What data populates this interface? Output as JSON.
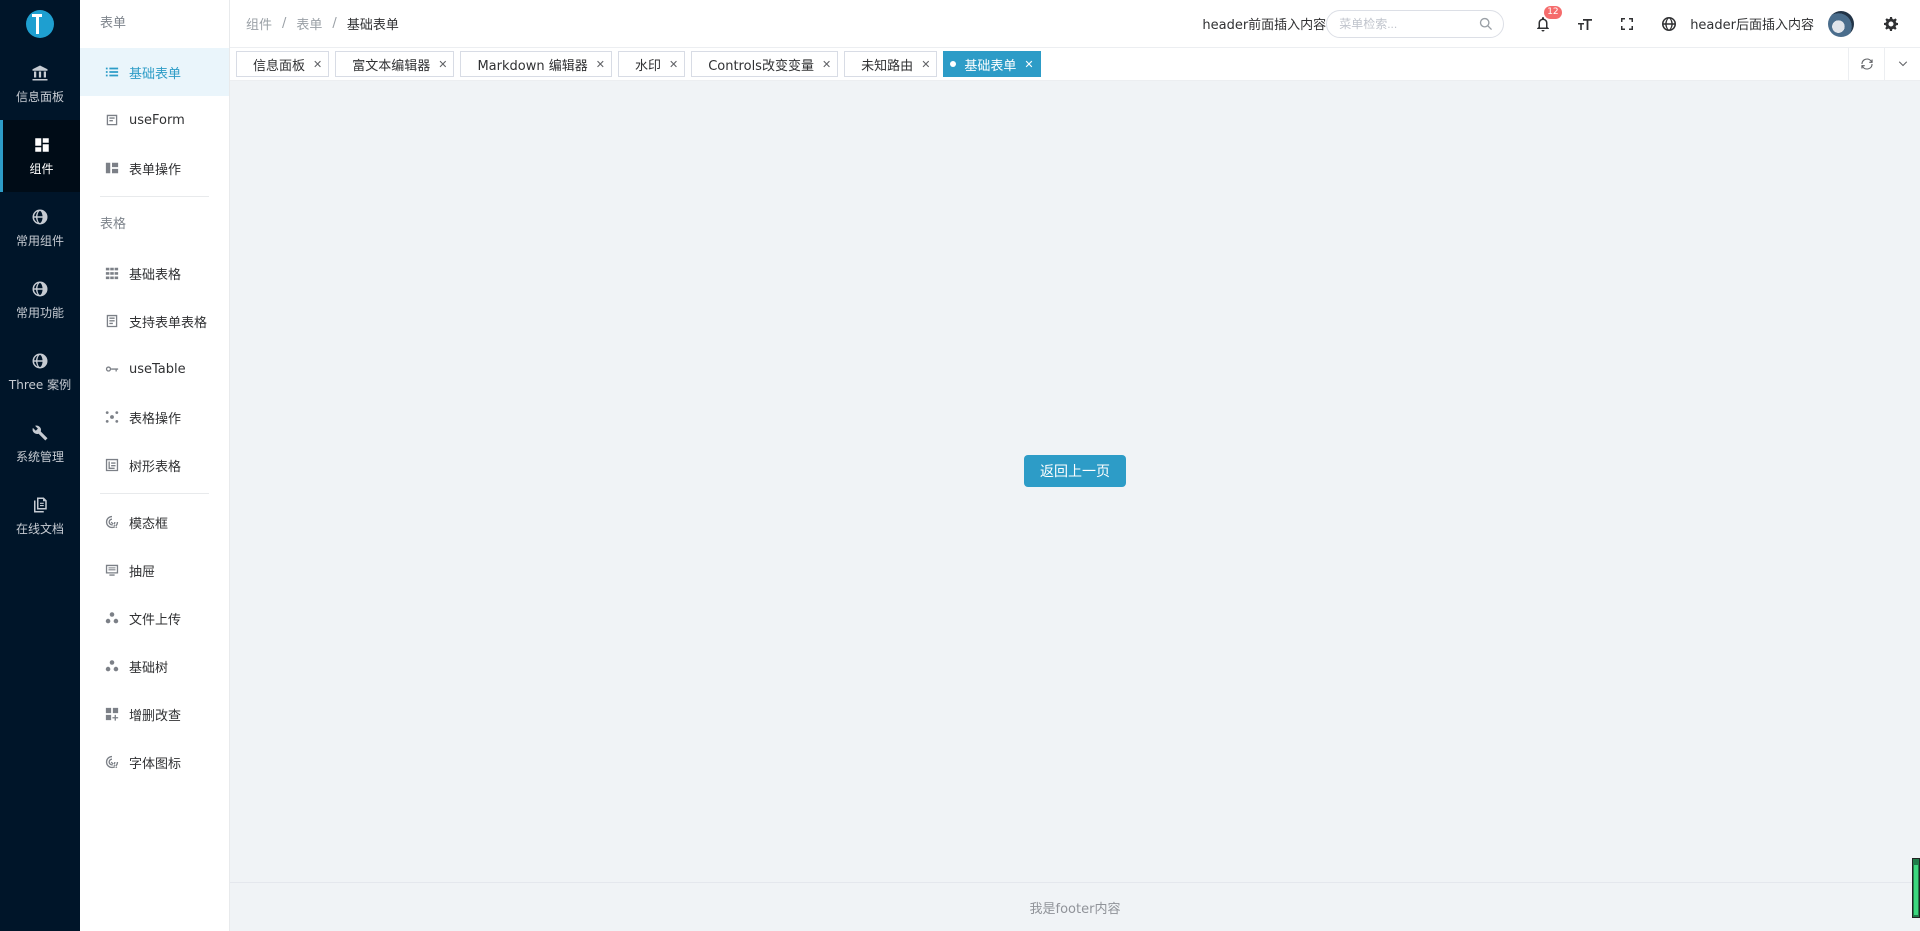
{
  "rail": {
    "items": [
      {
        "label": "信息面板",
        "icon": "bank-icon"
      },
      {
        "label": "组件",
        "icon": "dashboard-icon",
        "active": true
      },
      {
        "label": "常用组件",
        "icon": "globe-gear-icon"
      },
      {
        "label": "常用功能",
        "icon": "globe-gear-icon"
      },
      {
        "label": "Three 案例",
        "icon": "globe-gear-icon"
      },
      {
        "label": "系统管理",
        "icon": "wrench-icon"
      },
      {
        "label": "在线文档",
        "icon": "document-icon"
      }
    ]
  },
  "sidebar": {
    "group_form": "表单",
    "group_table": "表格",
    "items": [
      {
        "label": "基础表单",
        "icon": "list-icon",
        "active": true
      },
      {
        "label": "useForm",
        "icon": "form-icon"
      },
      {
        "label": "表单操作",
        "icon": "layout-icon"
      },
      {
        "label": "基础表格",
        "icon": "grid-icon"
      },
      {
        "label": "支持表单表格",
        "icon": "profile-icon"
      },
      {
        "label": "useTable",
        "icon": "key-icon"
      },
      {
        "label": "表格操作",
        "icon": "cluster-icon"
      },
      {
        "label": "树形表格",
        "icon": "tree-icon"
      },
      {
        "label": "模态框",
        "icon": "radar-icon"
      },
      {
        "label": "抽屉",
        "icon": "drawer-icon"
      },
      {
        "label": "文件上传",
        "icon": "dots-icon"
      },
      {
        "label": "基础树",
        "icon": "dots-icon"
      },
      {
        "label": "增删改查",
        "icon": "appstore-add-icon"
      },
      {
        "label": "字体图标",
        "icon": "radar-icon"
      }
    ]
  },
  "header": {
    "breadcrumb": [
      "组件",
      "表单",
      "基础表单"
    ],
    "before_text": "header前面插入内容",
    "search_placeholder": "菜单检索...",
    "notification_count": "12",
    "after_text": "header后面插入内容"
  },
  "tabs": [
    {
      "label": "信息面板"
    },
    {
      "label": "富文本编辑器"
    },
    {
      "label": "Markdown 编辑器"
    },
    {
      "label": "水印"
    },
    {
      "label": "Controls改变变量"
    },
    {
      "label": "未知路由"
    },
    {
      "label": "基础表单",
      "active": true
    }
  ],
  "main": {
    "back_button": "返回上一页"
  },
  "footer": {
    "text": "我是footer内容"
  },
  "colors": {
    "accent": "#2d9cc7",
    "rail_bg": "#001529",
    "content_bg": "#f0f3f6"
  }
}
